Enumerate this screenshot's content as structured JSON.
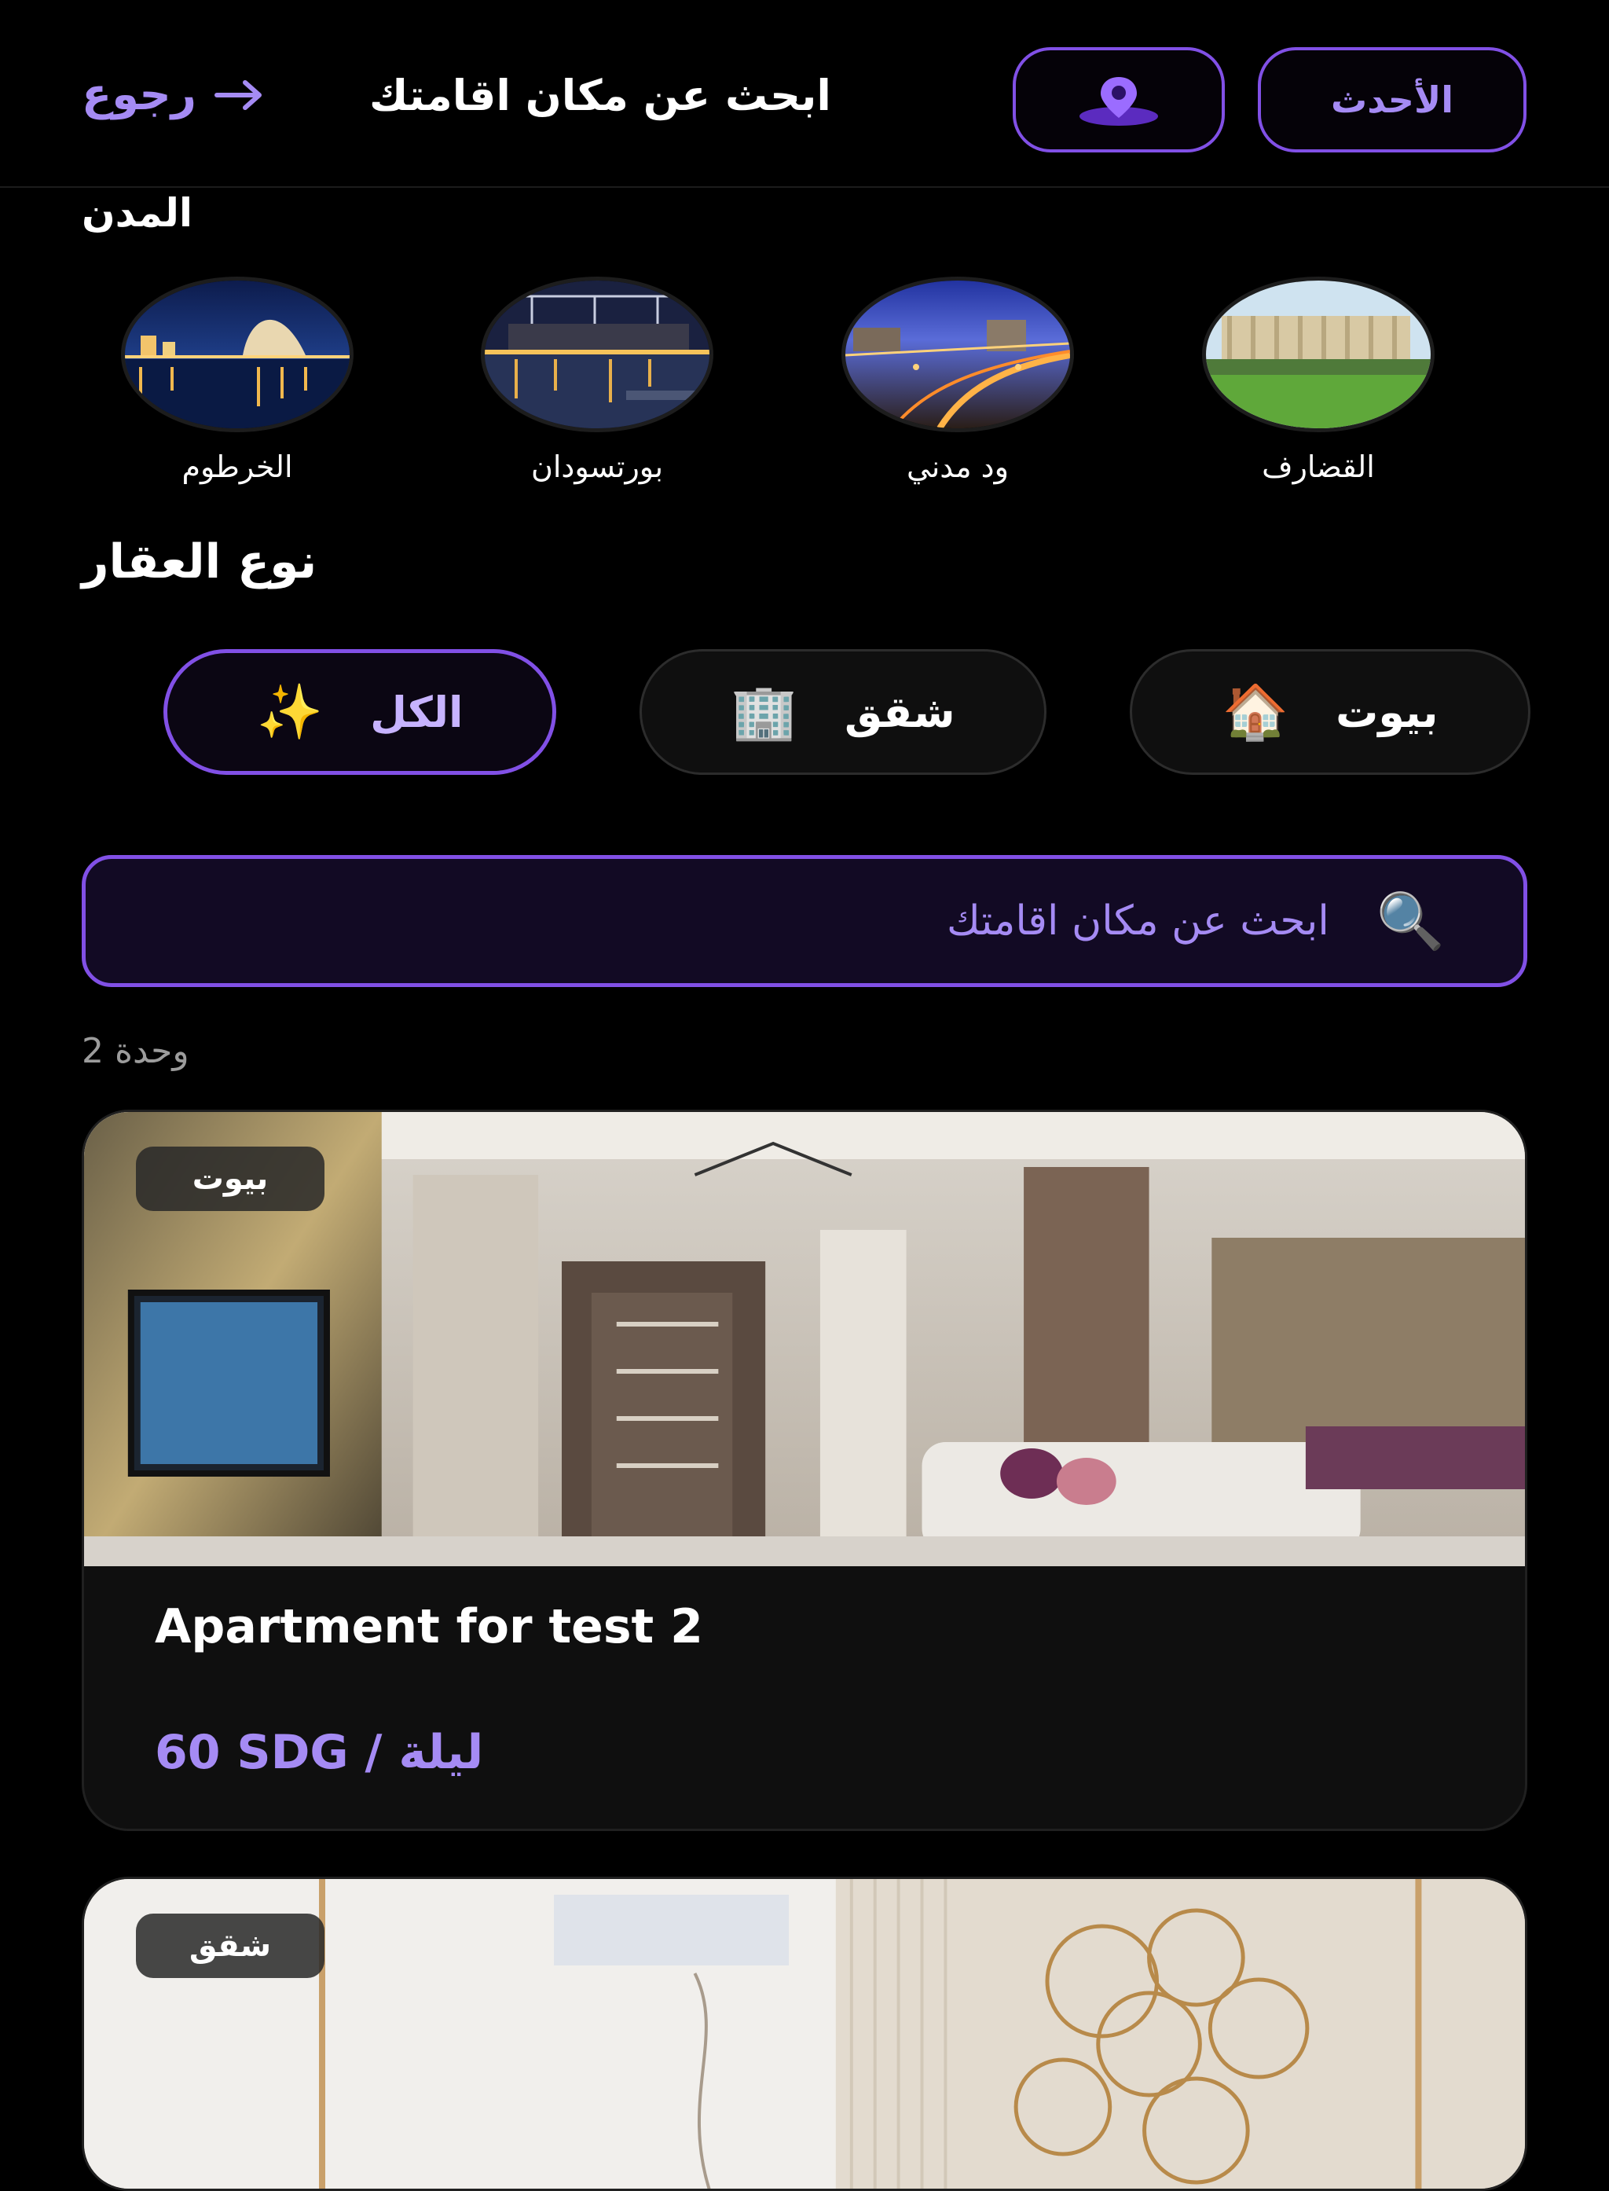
{
  "header": {
    "back_label": "رجوع",
    "title": "ابحث عن مكان اقامتك",
    "latest_label": "الأحدث",
    "map_icon": "map-pin-icon"
  },
  "cities": {
    "title": "المدن",
    "items": [
      {
        "label": "الخرطوم"
      },
      {
        "label": "بورتسودان"
      },
      {
        "label": "ود مدني"
      },
      {
        "label": "القضارف"
      }
    ]
  },
  "property_types": {
    "title": "نوع العقار",
    "items": [
      {
        "label": "الكل",
        "icon": "✨",
        "selected": true
      },
      {
        "label": "شقق",
        "icon": "🏢",
        "selected": false
      },
      {
        "label": "بيوت",
        "icon": "🏠",
        "selected": false
      }
    ]
  },
  "search": {
    "placeholder": "ابحث عن مكان اقامتك",
    "icon": "🔍"
  },
  "results": {
    "count_text": "2 وحدة",
    "listings": [
      {
        "badge": "بيوت",
        "title": "Apartment for test 2",
        "price_text": "60 SDG / ليلة"
      },
      {
        "badge": "شقق"
      }
    ]
  },
  "colors": {
    "accent": "#8150e6",
    "accent_text": "#a58bf4",
    "background": "#000000"
  }
}
